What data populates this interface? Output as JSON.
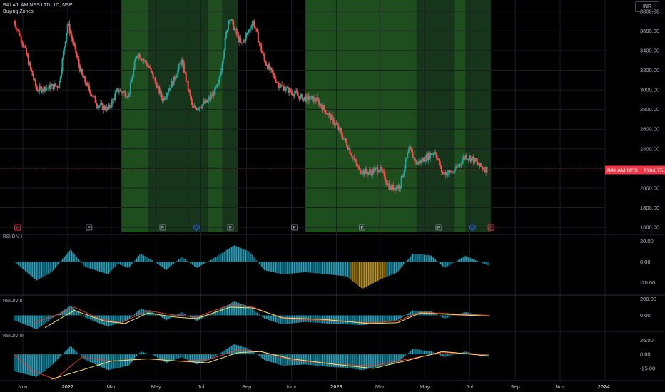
{
  "header": {
    "symbol_line": "BALAJI AMINES LTD, 1D, NSE",
    "indicator_name": "Buying Zones",
    "currency": "INR"
  },
  "panes": {
    "rsi1_title": "RSI DIV-I",
    "rsi2_title": "RSIDIV-II",
    "rsi3_title": "RSIDIV-III"
  },
  "price_tag": {
    "label": "BALAMINES",
    "value": "2184.75",
    "color": "#f23645"
  },
  "colors": {
    "up": "#26a69a",
    "down": "#ef5350",
    "zone_light": "#1e4d1e",
    "zone_dark": "#16351a",
    "histogram": "#2fb7d6",
    "histogram_signal": "#d4a72c",
    "ma_red": "#e53935",
    "ma_yellow": "#f5e663"
  },
  "events": {
    "earnings_marker": "E",
    "dividend_marker": "D"
  },
  "chart_data": [
    {
      "type": "candlestick",
      "title": "BALAJI AMINES LTD, 1D, NSE",
      "x_ticks": [
        "Nov",
        "2022",
        "Mar",
        "May",
        "Jul",
        "Sep",
        "Nov",
        "2023",
        "Mar",
        "May",
        "Jul",
        "Sep",
        "Nov",
        "2024"
      ],
      "y_ticks": [
        3800,
        3600,
        3400,
        3200,
        3000,
        2800,
        2600,
        2400,
        2200,
        2000,
        1800,
        1600
      ],
      "y_range": [
        1550,
        3900
      ],
      "last_price": 2184.75,
      "close_path": [
        {
          "date": "2021-10-20",
          "close": 3700
        },
        {
          "date": "2021-11-01",
          "close": 3480
        },
        {
          "date": "2021-11-20",
          "close": 3000
        },
        {
          "date": "2021-12-20",
          "close": 3050
        },
        {
          "date": "2022-01-01",
          "close": 3680
        },
        {
          "date": "2022-01-20",
          "close": 3150
        },
        {
          "date": "2022-02-10",
          "close": 2850
        },
        {
          "date": "2022-02-25",
          "close": 2800
        },
        {
          "date": "2022-03-10",
          "close": 3000
        },
        {
          "date": "2022-03-25",
          "close": 2950
        },
        {
          "date": "2022-04-05",
          "close": 3380
        },
        {
          "date": "2022-04-20",
          "close": 3250
        },
        {
          "date": "2022-05-10",
          "close": 2900
        },
        {
          "date": "2022-05-25",
          "close": 3100
        },
        {
          "date": "2022-06-05",
          "close": 3300
        },
        {
          "date": "2022-06-20",
          "close": 2800
        },
        {
          "date": "2022-07-10",
          "close": 2880
        },
        {
          "date": "2022-07-25",
          "close": 3050
        },
        {
          "date": "2022-08-08",
          "close": 3750
        },
        {
          "date": "2022-08-25",
          "close": 3450
        },
        {
          "date": "2022-09-10",
          "close": 3700
        },
        {
          "date": "2022-09-25",
          "close": 3300
        },
        {
          "date": "2022-10-15",
          "close": 3050
        },
        {
          "date": "2022-11-15",
          "close": 2920
        },
        {
          "date": "2022-12-05",
          "close": 2900
        },
        {
          "date": "2022-12-31",
          "close": 2650
        },
        {
          "date": "2023-01-15",
          "close": 2450
        },
        {
          "date": "2023-02-01",
          "close": 2180
        },
        {
          "date": "2023-02-15",
          "close": 2160
        },
        {
          "date": "2023-03-01",
          "close": 2200
        },
        {
          "date": "2023-03-15",
          "close": 2000
        },
        {
          "date": "2023-03-28",
          "close": 2020
        },
        {
          "date": "2023-04-10",
          "close": 2400
        },
        {
          "date": "2023-04-20",
          "close": 2250
        },
        {
          "date": "2023-05-01",
          "close": 2300
        },
        {
          "date": "2023-05-15",
          "close": 2380
        },
        {
          "date": "2023-05-25",
          "close": 2150
        },
        {
          "date": "2023-06-10",
          "close": 2170
        },
        {
          "date": "2023-06-25",
          "close": 2330
        },
        {
          "date": "2023-07-05",
          "close": 2300
        },
        {
          "date": "2023-07-15",
          "close": 2220
        },
        {
          "date": "2023-07-25",
          "close": 2184.75
        }
      ],
      "buying_zones": [
        {
          "start": "2022-03-15",
          "end": "2022-04-20",
          "shade": "light"
        },
        {
          "start": "2022-04-20",
          "end": "2022-06-15",
          "shade": "dark"
        },
        {
          "start": "2022-06-15",
          "end": "2022-07-10",
          "shade": "dark"
        },
        {
          "start": "2022-07-10",
          "end": "2022-07-30",
          "shade": "light"
        },
        {
          "start": "2022-07-30",
          "end": "2022-08-20",
          "shade": "dark"
        },
        {
          "start": "2022-11-20",
          "end": "2023-04-20",
          "shade": "light"
        },
        {
          "start": "2023-04-20",
          "end": "2023-05-25",
          "shade": "dark"
        },
        {
          "start": "2023-05-25",
          "end": "2023-06-10",
          "shade": "dark"
        },
        {
          "start": "2023-06-10",
          "end": "2023-06-25",
          "shade": "light"
        },
        {
          "start": "2023-06-25",
          "end": "2023-07-30",
          "shade": "dark"
        }
      ],
      "event_markers": [
        {
          "date": "2021-10-25",
          "kind": "E",
          "color": "red"
        },
        {
          "date": "2022-01-30",
          "kind": "E",
          "color": "gray"
        },
        {
          "date": "2022-05-10",
          "kind": "E",
          "color": "gray"
        },
        {
          "date": "2022-06-25",
          "kind": "D",
          "color": "blue"
        },
        {
          "date": "2022-08-10",
          "kind": "E",
          "color": "gray"
        },
        {
          "date": "2022-11-05",
          "kind": "E",
          "color": "gray"
        },
        {
          "date": "2023-02-05",
          "kind": "E",
          "color": "gray"
        },
        {
          "date": "2023-05-20",
          "kind": "E",
          "color": "gray"
        },
        {
          "date": "2023-07-05",
          "kind": "D",
          "color": "blue"
        },
        {
          "date": "2023-07-30",
          "kind": "E",
          "color": "red"
        }
      ]
    },
    {
      "type": "histogram",
      "title": "RSI DIV-I",
      "y_ticks": [
        20.0,
        0.0,
        -20.0
      ],
      "y_range": [
        -30,
        25
      ],
      "signal_segment": {
        "start": "2023-01-20",
        "end": "2023-03-10"
      },
      "values": [
        {
          "date": "2021-10-20",
          "v": 0
        },
        {
          "date": "2021-11-20",
          "v": -18
        },
        {
          "date": "2021-12-10",
          "v": -10
        },
        {
          "date": "2022-01-05",
          "v": 12
        },
        {
          "date": "2022-01-25",
          "v": -5
        },
        {
          "date": "2022-02-25",
          "v": -12
        },
        {
          "date": "2022-03-10",
          "v": -2
        },
        {
          "date": "2022-03-25",
          "v": -6
        },
        {
          "date": "2022-04-10",
          "v": 8
        },
        {
          "date": "2022-04-25",
          "v": 2
        },
        {
          "date": "2022-05-15",
          "v": -8
        },
        {
          "date": "2022-06-05",
          "v": 5
        },
        {
          "date": "2022-06-25",
          "v": -6
        },
        {
          "date": "2022-07-15",
          "v": 2
        },
        {
          "date": "2022-08-15",
          "v": 16
        },
        {
          "date": "2022-09-05",
          "v": 10
        },
        {
          "date": "2022-09-25",
          "v": -8
        },
        {
          "date": "2022-10-20",
          "v": -12
        },
        {
          "date": "2022-11-20",
          "v": -10
        },
        {
          "date": "2022-12-20",
          "v": -12
        },
        {
          "date": "2023-01-15",
          "v": -14
        },
        {
          "date": "2023-02-05",
          "v": -26
        },
        {
          "date": "2023-03-05",
          "v": -16
        },
        {
          "date": "2023-03-25",
          "v": -10
        },
        {
          "date": "2023-04-15",
          "v": 8
        },
        {
          "date": "2023-05-10",
          "v": 6
        },
        {
          "date": "2023-05-28",
          "v": -6
        },
        {
          "date": "2023-06-25",
          "v": 6
        },
        {
          "date": "2023-07-28",
          "v": -4
        }
      ]
    },
    {
      "type": "histogram",
      "title": "RSIDIV-II",
      "y_ticks": [
        200.0,
        0.0
      ],
      "y_range": [
        -170,
        230
      ],
      "values": [
        {
          "date": "2021-10-20",
          "v": -60
        },
        {
          "date": "2021-11-20",
          "v": -170
        },
        {
          "date": "2021-12-10",
          "v": -40
        },
        {
          "date": "2022-01-05",
          "v": 120
        },
        {
          "date": "2022-01-25",
          "v": -30
        },
        {
          "date": "2022-02-25",
          "v": -140
        },
        {
          "date": "2022-03-25",
          "v": -50
        },
        {
          "date": "2022-04-10",
          "v": 80
        },
        {
          "date": "2022-04-25",
          "v": 50
        },
        {
          "date": "2022-05-15",
          "v": -60
        },
        {
          "date": "2022-06-05",
          "v": 40
        },
        {
          "date": "2022-06-25",
          "v": -70
        },
        {
          "date": "2022-07-15",
          "v": 20
        },
        {
          "date": "2022-08-15",
          "v": 170
        },
        {
          "date": "2022-09-05",
          "v": 110
        },
        {
          "date": "2022-09-25",
          "v": -40
        },
        {
          "date": "2022-10-20",
          "v": -110
        },
        {
          "date": "2022-11-20",
          "v": -80
        },
        {
          "date": "2022-12-20",
          "v": -100
        },
        {
          "date": "2023-01-15",
          "v": -110
        },
        {
          "date": "2023-02-05",
          "v": -120
        },
        {
          "date": "2023-03-05",
          "v": -90
        },
        {
          "date": "2023-03-25",
          "v": -60
        },
        {
          "date": "2023-04-15",
          "v": 60
        },
        {
          "date": "2023-05-10",
          "v": 50
        },
        {
          "date": "2023-05-28",
          "v": -40
        },
        {
          "date": "2023-06-25",
          "v": 40
        },
        {
          "date": "2023-07-28",
          "v": -20
        }
      ],
      "ma_red": [
        {
          "date": "2021-11-15",
          "v": -90
        },
        {
          "date": "2021-12-10",
          "v": -20
        },
        {
          "date": "2022-01-10",
          "v": 100
        },
        {
          "date": "2022-02-15",
          "v": -50
        },
        {
          "date": "2022-03-15",
          "v": -90
        },
        {
          "date": "2022-04-20",
          "v": 60
        },
        {
          "date": "2022-05-20",
          "v": 10
        },
        {
          "date": "2022-06-25",
          "v": -20
        },
        {
          "date": "2022-08-10",
          "v": 130
        },
        {
          "date": "2022-09-10",
          "v": 100
        },
        {
          "date": "2022-10-20",
          "v": -40
        },
        {
          "date": "2022-12-15",
          "v": -60
        },
        {
          "date": "2023-02-15",
          "v": -90
        },
        {
          "date": "2023-03-25",
          "v": -70
        },
        {
          "date": "2023-04-25",
          "v": 40
        },
        {
          "date": "2023-06-05",
          "v": 20
        },
        {
          "date": "2023-07-28",
          "v": 0
        }
      ],
      "ma_yellow": [
        {
          "date": "2021-12-01",
          "v": -150
        },
        {
          "date": "2022-01-10",
          "v": 60
        },
        {
          "date": "2022-02-20",
          "v": -70
        },
        {
          "date": "2022-03-20",
          "v": -100
        },
        {
          "date": "2022-04-20",
          "v": 30
        },
        {
          "date": "2022-05-25",
          "v": -20
        },
        {
          "date": "2022-06-25",
          "v": -40
        },
        {
          "date": "2022-08-10",
          "v": 100
        },
        {
          "date": "2022-09-10",
          "v": 90
        },
        {
          "date": "2022-10-20",
          "v": -30
        },
        {
          "date": "2022-12-15",
          "v": -50
        },
        {
          "date": "2023-02-15",
          "v": -100
        },
        {
          "date": "2023-03-25",
          "v": -90
        },
        {
          "date": "2023-04-25",
          "v": 30
        },
        {
          "date": "2023-06-05",
          "v": 10
        },
        {
          "date": "2023-07-28",
          "v": -10
        }
      ]
    },
    {
      "type": "histogram",
      "title": "RSIDIV-III",
      "y_ticks": [
        25.0,
        0.0,
        -25.0
      ],
      "y_range": [
        -44,
        38
      ],
      "values": [
        {
          "date": "2021-10-20",
          "v": -30
        },
        {
          "date": "2021-11-20",
          "v": -40
        },
        {
          "date": "2021-12-10",
          "v": -20
        },
        {
          "date": "2022-01-05",
          "v": 15
        },
        {
          "date": "2022-01-25",
          "v": -10
        },
        {
          "date": "2022-02-25",
          "v": -28
        },
        {
          "date": "2022-03-25",
          "v": -20
        },
        {
          "date": "2022-04-10",
          "v": 5
        },
        {
          "date": "2022-04-25",
          "v": 0
        },
        {
          "date": "2022-05-15",
          "v": -15
        },
        {
          "date": "2022-06-05",
          "v": -5
        },
        {
          "date": "2022-06-25",
          "v": -18
        },
        {
          "date": "2022-07-15",
          "v": -8
        },
        {
          "date": "2022-08-15",
          "v": 18
        },
        {
          "date": "2022-09-05",
          "v": 10
        },
        {
          "date": "2022-09-25",
          "v": -10
        },
        {
          "date": "2022-10-20",
          "v": -20
        },
        {
          "date": "2022-11-20",
          "v": -18
        },
        {
          "date": "2022-12-20",
          "v": -22
        },
        {
          "date": "2023-01-15",
          "v": -24
        },
        {
          "date": "2023-02-05",
          "v": -28
        },
        {
          "date": "2023-03-05",
          "v": -20
        },
        {
          "date": "2023-03-25",
          "v": -15
        },
        {
          "date": "2023-04-15",
          "v": 10
        },
        {
          "date": "2023-05-10",
          "v": 5
        },
        {
          "date": "2023-05-28",
          "v": -5
        },
        {
          "date": "2023-06-25",
          "v": 5
        },
        {
          "date": "2023-07-28",
          "v": -5
        }
      ],
      "ma_red": [
        {
          "date": "2021-10-20",
          "v": 0
        },
        {
          "date": "2021-11-15",
          "v": -30
        },
        {
          "date": "2021-12-15",
          "v": -44
        },
        {
          "date": "2022-01-20",
          "v": -5
        },
        {
          "date": "2022-03-01",
          "v": -12
        },
        {
          "date": "2022-04-20",
          "v": -8
        },
        {
          "date": "2022-06-01",
          "v": -12
        },
        {
          "date": "2022-07-10",
          "v": -10
        },
        {
          "date": "2022-08-20",
          "v": 8
        },
        {
          "date": "2022-09-20",
          "v": 5
        },
        {
          "date": "2022-11-01",
          "v": -10
        },
        {
          "date": "2023-01-01",
          "v": -18
        },
        {
          "date": "2023-02-20",
          "v": -20
        },
        {
          "date": "2023-04-10",
          "v": -8
        },
        {
          "date": "2023-05-25",
          "v": 3
        },
        {
          "date": "2023-07-28",
          "v": 0
        }
      ],
      "ma_yellow": [
        {
          "date": "2021-12-10",
          "v": -44
        },
        {
          "date": "2022-01-20",
          "v": -28
        },
        {
          "date": "2022-03-01",
          "v": -12
        },
        {
          "date": "2022-04-20",
          "v": -8
        },
        {
          "date": "2022-06-01",
          "v": -12
        },
        {
          "date": "2022-07-10",
          "v": -15
        },
        {
          "date": "2022-08-20",
          "v": 3
        },
        {
          "date": "2022-09-20",
          "v": 5
        },
        {
          "date": "2022-11-01",
          "v": -8
        },
        {
          "date": "2023-01-01",
          "v": -18
        },
        {
          "date": "2023-02-20",
          "v": -25
        },
        {
          "date": "2023-04-10",
          "v": -10
        },
        {
          "date": "2023-05-25",
          "v": 5
        },
        {
          "date": "2023-07-28",
          "v": -3
        }
      ]
    }
  ]
}
